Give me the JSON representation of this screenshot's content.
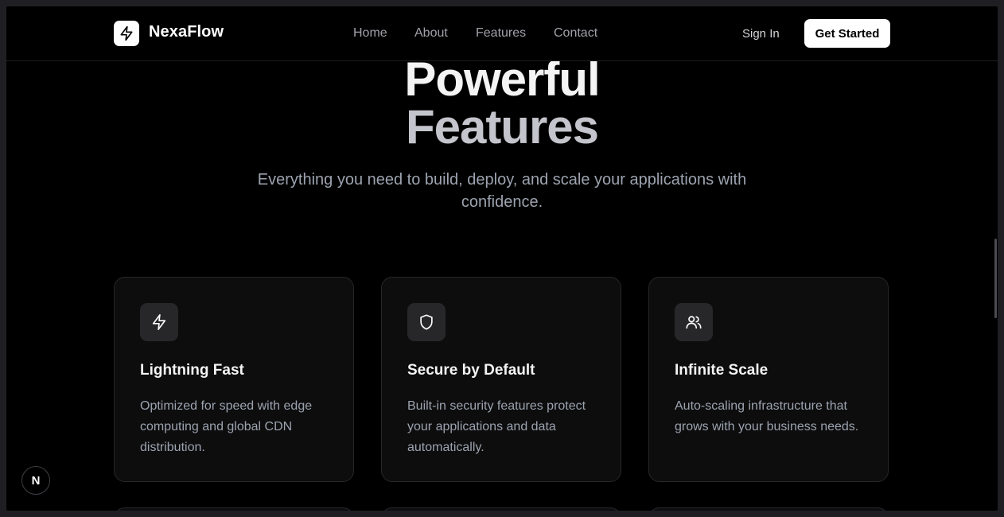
{
  "brand": {
    "name": "NexaFlow",
    "logo_icon": "lightning-bolt-icon"
  },
  "nav": {
    "links": [
      "Home",
      "About",
      "Features",
      "Contact"
    ],
    "sign_in": "Sign In",
    "cta": "Get Started"
  },
  "hero": {
    "title_line1": "Powerful",
    "title_line2": "Features",
    "subtitle": "Everything you need to build, deploy, and scale your applications with confidence."
  },
  "features": [
    {
      "icon": "lightning-bolt-icon",
      "title": "Lightning Fast",
      "description": "Optimized for speed with edge computing and global CDN distribution."
    },
    {
      "icon": "shield-icon",
      "title": "Secure by Default",
      "description": "Built-in security features protect your applications and data automatically."
    },
    {
      "icon": "users-icon",
      "title": "Infinite Scale",
      "description": "Auto-scaling infrastructure that grows with your business needs."
    }
  ],
  "badge": {
    "label": "N"
  },
  "colors": {
    "background": "#000000",
    "card": "#0d0d0e",
    "border": "#27272a",
    "text_muted": "#9ca3af",
    "accent": "#ffffff"
  }
}
